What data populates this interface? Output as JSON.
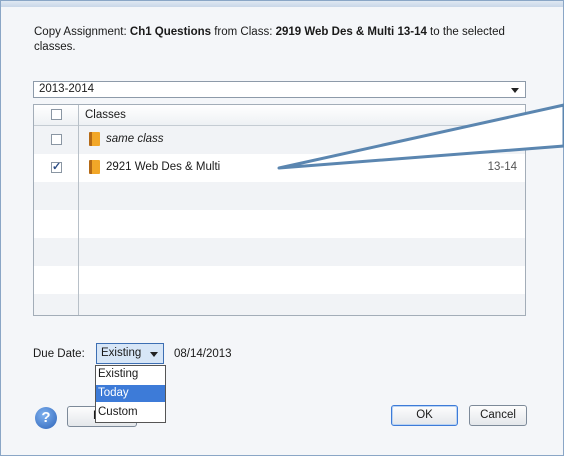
{
  "message": {
    "prefix": "Copy Assignment: ",
    "assignment": "Ch1 Questions",
    "middle": " from Class: ",
    "class_name": "2919 Web Des & Multi 13-14",
    "suffix": " to the selected classes."
  },
  "year_select": {
    "value": "2013-2014"
  },
  "grid": {
    "header": "Classes",
    "rows": [
      {
        "name": "same class",
        "term": "",
        "checked": false,
        "italic": true
      },
      {
        "name": "2921 Web Des & Multi",
        "term": "13-14",
        "checked": true,
        "italic": false
      }
    ]
  },
  "due": {
    "label": "Due Date:",
    "selected": "Existing",
    "date": "08/14/2013",
    "options": [
      "Existing",
      "Today",
      "Custom"
    ],
    "highlighted": "Today"
  },
  "buttons": {
    "help": "?",
    "back": "B",
    "ok": "OK",
    "cancel": "Cancel"
  },
  "colors": {
    "accent": "#3d7bd8",
    "callout": "#5b86b0"
  }
}
